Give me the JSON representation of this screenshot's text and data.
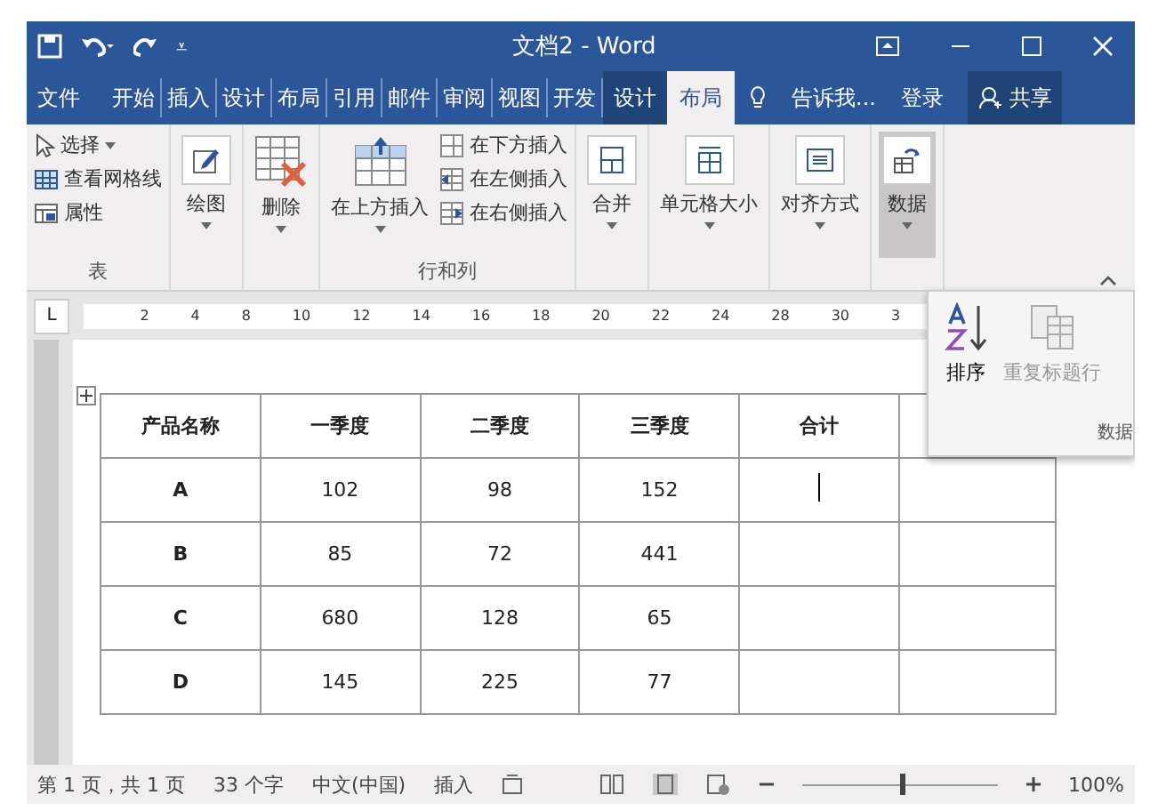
{
  "window": {
    "title": "文档2 - Word"
  },
  "quick_access": {
    "customize": "⩡"
  },
  "tabs": [
    {
      "label": "文件",
      "kind": "file",
      "selected": false
    },
    {
      "label": "开始",
      "kind": "tab",
      "selected": false
    },
    {
      "label": "插入",
      "kind": "tab",
      "selected": false
    },
    {
      "label": "设计",
      "kind": "tab",
      "selected": false
    },
    {
      "label": "布局",
      "kind": "tab",
      "selected": false
    },
    {
      "label": "引用",
      "kind": "tab",
      "selected": false
    },
    {
      "label": "邮件",
      "kind": "tab",
      "selected": false
    },
    {
      "label": "审阅",
      "kind": "tab",
      "selected": false
    },
    {
      "label": "视图",
      "kind": "tab",
      "selected": false
    },
    {
      "label": "开发",
      "kind": "tab",
      "selected": false
    },
    {
      "label": "设计",
      "kind": "context",
      "selected": false
    },
    {
      "label": "布局",
      "kind": "context",
      "selected": true
    }
  ],
  "tell_me": "告诉我...",
  "sign_in": "登录",
  "share": "共享",
  "ribbon": {
    "table_group": {
      "label": "表",
      "select": "选择",
      "gridlines": "查看网格线",
      "properties": "属性"
    },
    "draw": "绘图",
    "delete": "删除",
    "rows_cols": {
      "label": "行和列",
      "above": "在上方插入",
      "below": "在下方插入",
      "left": "在左侧插入",
      "right": "在右侧插入"
    },
    "merge": "合并",
    "cell_size": "单元格大小",
    "alignment": "对齐方式",
    "data": {
      "label": "数据",
      "pressed": true
    }
  },
  "ruler": {
    "tab_marker": "L",
    "numbers": [
      "2",
      "4",
      "8",
      "10",
      "12",
      "14",
      "16",
      "18",
      "20",
      "22",
      "24",
      "28",
      "30",
      "3"
    ]
  },
  "data_menu": {
    "sort": "排序",
    "repeat_header": "重复标题行",
    "group_label": "数据"
  },
  "table": {
    "columns": [
      "产品名称",
      "一季度",
      "二季度",
      "三季度",
      "合计"
    ],
    "rows": [
      [
        "A",
        "102",
        "98",
        "152",
        ""
      ],
      [
        "B",
        "85",
        "72",
        "441",
        ""
      ],
      [
        "C",
        "680",
        "128",
        "65",
        ""
      ],
      [
        "D",
        "145",
        "225",
        "77",
        ""
      ]
    ]
  },
  "status_bar": {
    "page": "第 1 页，共 1 页",
    "words": "33 个字",
    "language": "中文(中国)",
    "mode": "插入",
    "zoom": {
      "level": 0.5
    },
    "zoom_text": "100%"
  }
}
